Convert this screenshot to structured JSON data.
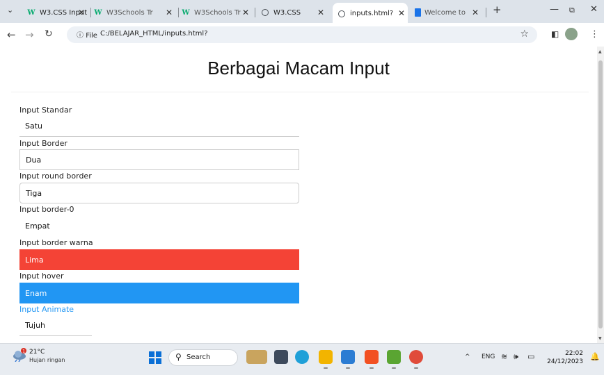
{
  "browser": {
    "tabs": [
      {
        "title": "W3.CSS Input",
        "icon": "w3schools-logo",
        "active": false
      },
      {
        "title": "W3Schools Tr",
        "icon": "w3schools-logo",
        "active": false
      },
      {
        "title": "W3Schools Tr",
        "icon": "w3schools-logo",
        "active": false
      },
      {
        "title": "W3.CSS",
        "icon": "globe-icon",
        "active": false
      },
      {
        "title": "inputs.html?",
        "icon": "globe-icon",
        "active": true
      },
      {
        "title": "Welcome to",
        "icon": "document-icon",
        "active": false
      }
    ],
    "new_tab_label": "+",
    "address": {
      "scheme_label": "File",
      "url": "C:/BELAJAR_HTML/inputs.html?"
    }
  },
  "page": {
    "title": "Berbagai Macam Input",
    "fields": [
      {
        "label": "Input Standar",
        "value": "Satu",
        "style": "standar"
      },
      {
        "label": "Input Border",
        "value": "Dua",
        "style": "border"
      },
      {
        "label": "Input round border",
        "value": "Tiga",
        "style": "round"
      },
      {
        "label": "Input border-0",
        "value": "Empat",
        "style": "border0"
      },
      {
        "label": "Input border warna",
        "value": "Lima",
        "style": "red"
      },
      {
        "label": "Input hover",
        "value": "Enam",
        "style": "blue"
      },
      {
        "label": "Input Animate",
        "value": "Tujuh",
        "style": "animate"
      }
    ],
    "colors": {
      "red": "#f44336",
      "blue": "#2196f3"
    }
  },
  "taskbar": {
    "weather": {
      "badge": "1",
      "temp": "21°C",
      "desc": "Hujan ringan"
    },
    "search_label": "Search",
    "tray": {
      "chevron": "^",
      "language": "ENG"
    },
    "clock": {
      "time": "22:02",
      "date": "24/12/2023"
    }
  }
}
